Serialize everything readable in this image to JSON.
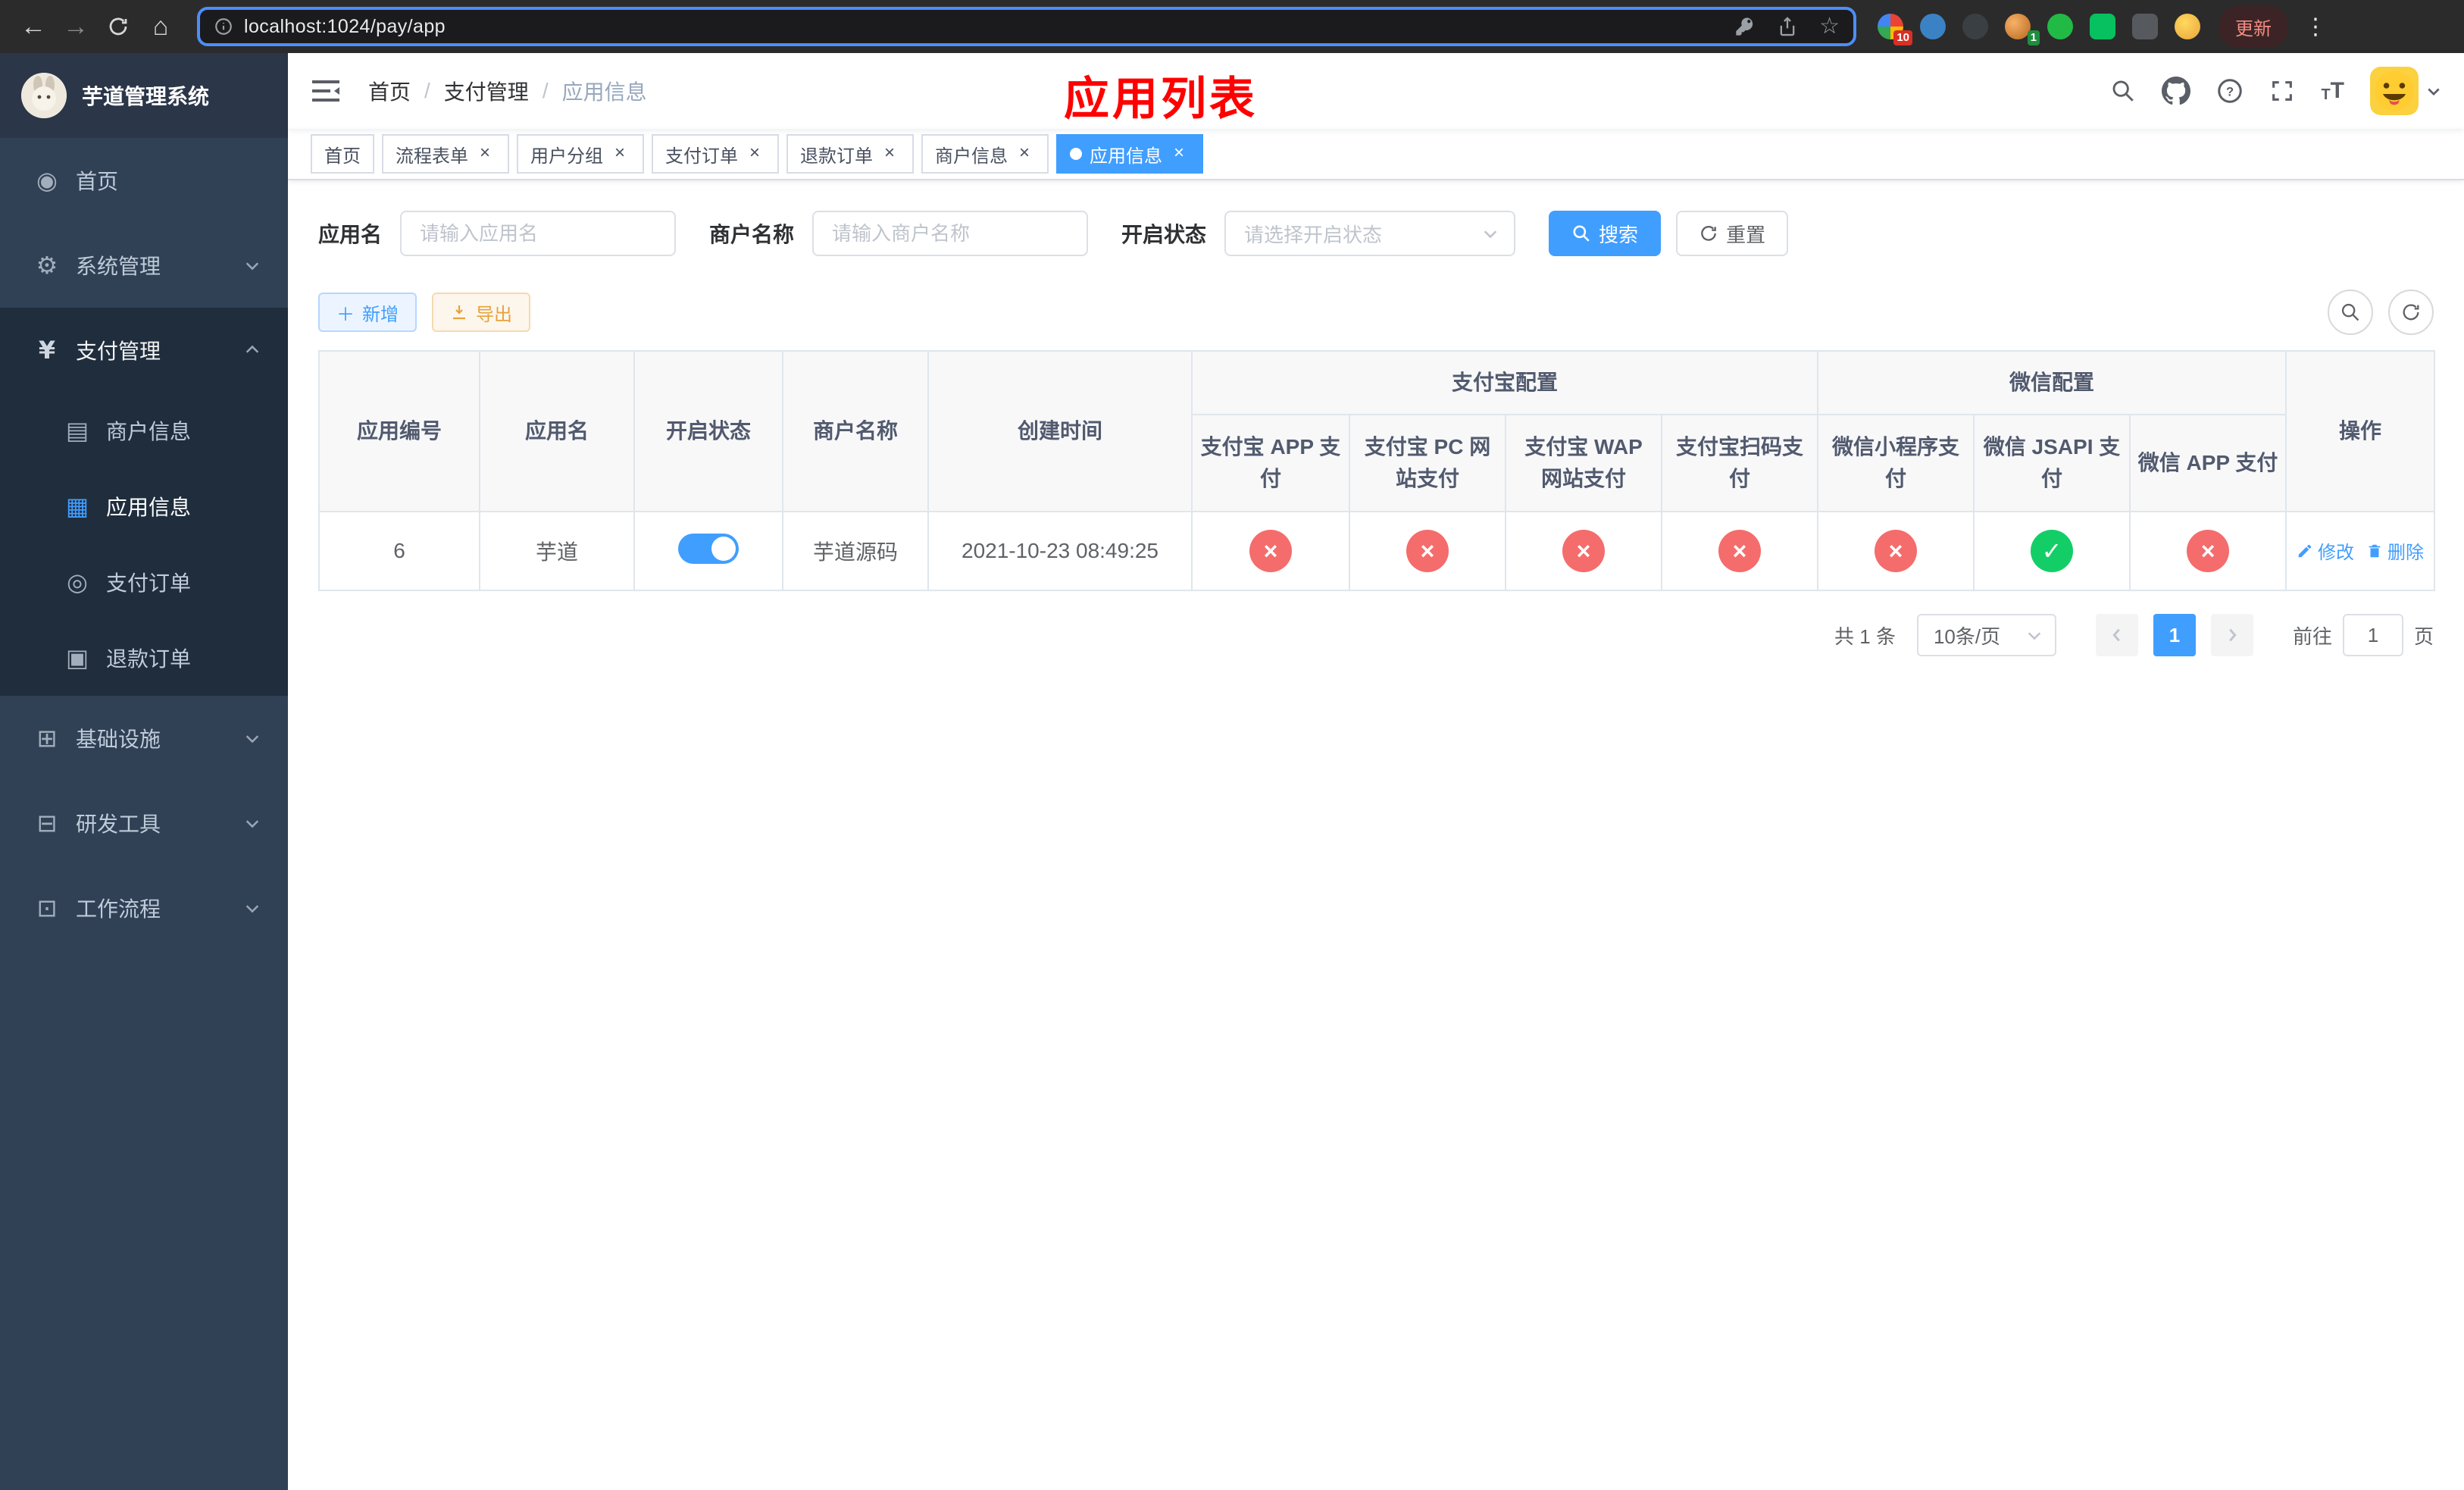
{
  "browser": {
    "url": "localhost:1024/pay/app",
    "update_button": "更新",
    "ext_badge_1": "10",
    "ext_badge_2": "1"
  },
  "sidebar": {
    "logo_title": "芋道管理系统",
    "items": [
      {
        "label": "首页",
        "glyph": "◉"
      },
      {
        "label": "系统管理",
        "glyph": "⚙"
      },
      {
        "label": "支付管理",
        "glyph": "¥"
      },
      {
        "label": "商户信息",
        "glyph": "▤"
      },
      {
        "label": "应用信息",
        "glyph": "▦"
      },
      {
        "label": "支付订单",
        "glyph": "◎"
      },
      {
        "label": "退款订单",
        "glyph": "▣"
      },
      {
        "label": "基础设施",
        "glyph": "⊞"
      },
      {
        "label": "研发工具",
        "glyph": "⊟"
      },
      {
        "label": "工作流程",
        "glyph": "⊡"
      }
    ]
  },
  "navbar": {
    "breadcrumb": {
      "home": "首页",
      "section": "支付管理",
      "current": "应用信息"
    },
    "overlay_title": "应用列表"
  },
  "tabs": [
    {
      "label": "首页"
    },
    {
      "label": "流程表单"
    },
    {
      "label": "用户分组"
    },
    {
      "label": "支付订单"
    },
    {
      "label": "退款订单"
    },
    {
      "label": "商户信息"
    },
    {
      "label": "应用信息"
    }
  ],
  "filters": {
    "app_name_label": "应用名",
    "app_name_placeholder": "请输入应用名",
    "merchant_label": "商户名称",
    "merchant_placeholder": "请输入商户名称",
    "status_label": "开启状态",
    "status_placeholder": "请选择开启状态",
    "search_button": "搜索",
    "reset_button": "重置"
  },
  "toolbar": {
    "add_button": "新增",
    "export_button": "导出"
  },
  "table": {
    "columns": {
      "id": "应用编号",
      "name": "应用名",
      "status": "开启状态",
      "merchant": "商户名称",
      "created": "创建时间",
      "actions": "操作"
    },
    "groups": {
      "alipay": "支付宝配置",
      "wechat": "微信配置"
    },
    "sub": {
      "alipay_app": "支付宝 APP 支付",
      "alipay_pc": "支付宝 PC 网站支付",
      "alipay_wap": "支付宝 WAP 网站支付",
      "alipay_qr": "支付宝扫码支付",
      "wx_mini": "微信小程序支付",
      "wx_jsapi": "微信 JSAPI 支付",
      "wx_app": "微信 APP 支付"
    },
    "glyphs": {
      "cross": "×",
      "check": "✓"
    },
    "row": {
      "id": "6",
      "name": "芋道",
      "merchant": "芋道源码",
      "created": "2021-10-23 08:49:25",
      "edit": "修改",
      "delete": "删除"
    }
  },
  "pagination": {
    "total": "共 1 条",
    "page_size": "10条/页",
    "page": "1",
    "goto_label": "前往",
    "goto_value": "1",
    "goto_unit": "页"
  },
  "colors": {
    "primary": "#409EFF",
    "danger": "#f56c6c",
    "success": "#13ce66"
  }
}
